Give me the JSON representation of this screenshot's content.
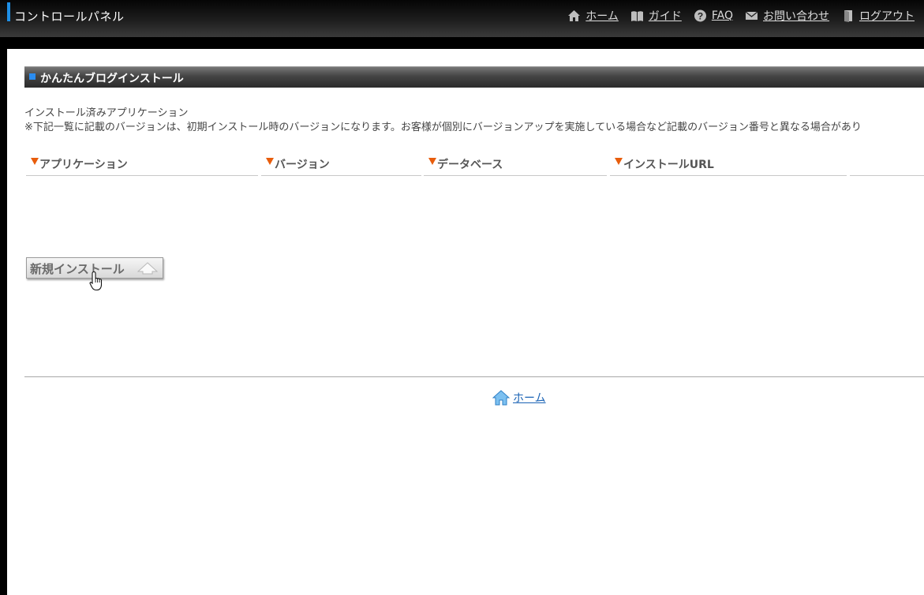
{
  "header": {
    "title": "コントロールパネル",
    "nav": [
      {
        "label": "ホーム",
        "icon": "home-icon"
      },
      {
        "label": "ガイド",
        "icon": "book-icon"
      },
      {
        "label": "FAQ",
        "icon": "question-icon"
      },
      {
        "label": "お問い合わせ",
        "icon": "mail-icon"
      },
      {
        "label": "ログアウト",
        "icon": "logout-door-icon"
      }
    ]
  },
  "section": {
    "title": "かんたんブログインストール",
    "description_line1": "インストール済みアプリケーション",
    "description_line2": "※下記一覧に記載のバージョンは、初期インストール時のバージョンになります。お客様が個別にバージョンアップを実施している場合など記載のバージョン番号と異なる場合があり"
  },
  "table": {
    "columns": [
      "アプリケーション",
      "バージョン",
      "データベース",
      "インストールURL"
    ],
    "rows": []
  },
  "install_button": {
    "label": "新規インストール",
    "icon": "up-arrow-icon"
  },
  "footer": {
    "home_label": "ホーム",
    "icon": "home-icon"
  },
  "colors": {
    "accent_blue": "#1e8fe6",
    "sort_triangle": "#e85d0c",
    "link_blue": "#1a63b5"
  }
}
